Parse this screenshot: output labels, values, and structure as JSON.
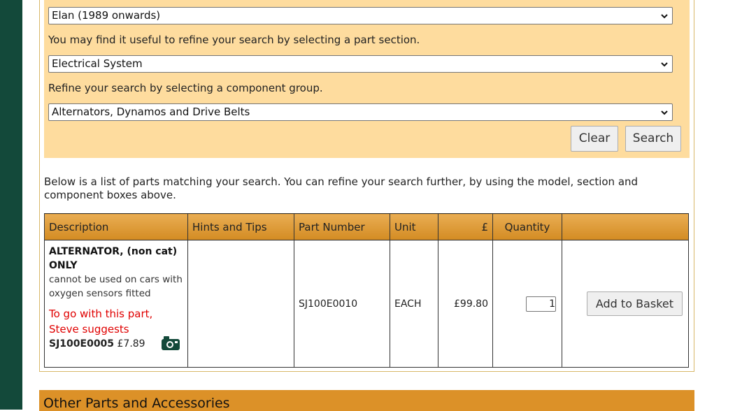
{
  "search": {
    "model_select_value": "Elan (1989 onwards)",
    "section_hint": "You may find it useful to refine your search by selecting a part section.",
    "section_select_value": "Electrical System",
    "component_hint": "Refine your search by selecting a component group.",
    "component_select_value": "Alternators, Dynamos and Drive Belts",
    "clear_label": "Clear",
    "search_label": "Search"
  },
  "intro": "Below is a list of parts matching your search. You can refine your search further, by using the model, section and component boxes above.",
  "table": {
    "headers": [
      "Description",
      "Hints and Tips",
      "Part Number",
      "Unit",
      "£",
      "Quantity",
      ""
    ],
    "rows": [
      {
        "description_title": "ALTERNATOR, (non cat) ONLY",
        "description_note": "cannot be used on cars with oxygen sensors fitted",
        "suggestion": "To go with this part, Steve suggests",
        "suggested_part": "SJ100E0005",
        "suggested_price": "£7.89",
        "hints": "",
        "part_number": "SJ100E0010",
        "unit": "EACH",
        "price": "£99.80",
        "quantity": "1",
        "basket_label": "Add to Basket"
      }
    ]
  },
  "bottom": {
    "heading": "Other Parts and Accessories"
  },
  "icons": {
    "dropdown": "chevron-down-icon",
    "camera": "camera-icon"
  },
  "colors": {
    "sidebar": "#13493a",
    "panel": "#fedc9e",
    "header": "#dc9128",
    "suggest": "#e00000"
  }
}
